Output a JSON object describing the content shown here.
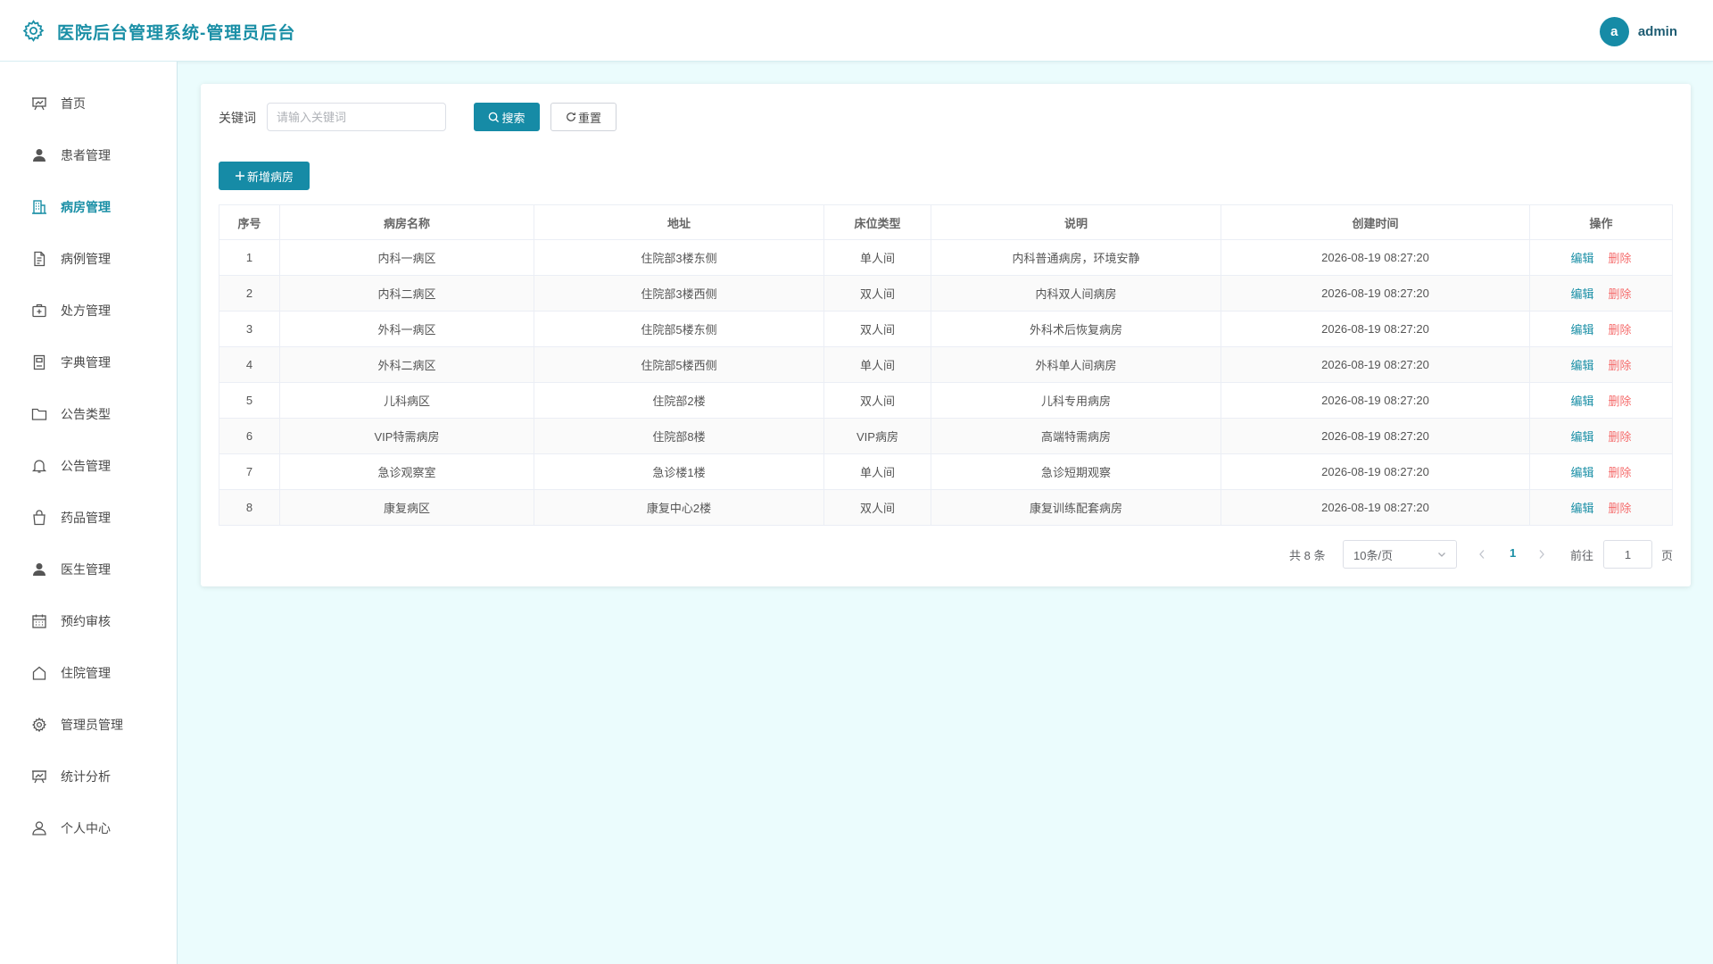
{
  "header": {
    "title": "医院后台管理系统-管理员后台",
    "avatar_letter": "a",
    "user_name": "admin"
  },
  "colors": {
    "accent": "#168ba6",
    "danger": "#f56c6c",
    "background": "#ebfcfd"
  },
  "sidebar": {
    "items": [
      {
        "label": "首页",
        "icon": "presentation-icon"
      },
      {
        "label": "患者管理",
        "icon": "user-filled-icon"
      },
      {
        "label": "病房管理",
        "icon": "building-icon",
        "active": true
      },
      {
        "label": "病例管理",
        "icon": "document-icon"
      },
      {
        "label": "处方管理",
        "icon": "first-aid-kit-icon"
      },
      {
        "label": "字典管理",
        "icon": "notebook-icon"
      },
      {
        "label": "公告类型",
        "icon": "folder-icon"
      },
      {
        "label": "公告管理",
        "icon": "bell-icon"
      },
      {
        "label": "药品管理",
        "icon": "shopping-bag-icon"
      },
      {
        "label": "医生管理",
        "icon": "user-filled-icon"
      },
      {
        "label": "预约审核",
        "icon": "calendar-icon"
      },
      {
        "label": "住院管理",
        "icon": "house-icon"
      },
      {
        "label": "管理员管理",
        "icon": "gear-icon"
      },
      {
        "label": "统计分析",
        "icon": "presentation-icon"
      },
      {
        "label": "个人中心",
        "icon": "user-icon"
      }
    ]
  },
  "search": {
    "label": "关键词",
    "placeholder": "请输入关键词",
    "search_label": "搜索",
    "reset_label": "重置"
  },
  "toolbar": {
    "add_label": "新增病房"
  },
  "table": {
    "headers": [
      "序号",
      "病房名称",
      "地址",
      "床位类型",
      "说明",
      "创建时间",
      "操作"
    ],
    "rows": [
      [
        "1",
        "内科一病区",
        "住院部3楼东侧",
        "单人间",
        "内科普通病房，环境安静",
        "2026-08-19 08:27:20"
      ],
      [
        "2",
        "内科二病区",
        "住院部3楼西侧",
        "双人间",
        "内科双人间病房",
        "2026-08-19 08:27:20"
      ],
      [
        "3",
        "外科一病区",
        "住院部5楼东侧",
        "双人间",
        "外科术后恢复病房",
        "2026-08-19 08:27:20"
      ],
      [
        "4",
        "外科二病区",
        "住院部5楼西侧",
        "单人间",
        "外科单人间病房",
        "2026-08-19 08:27:20"
      ],
      [
        "5",
        "儿科病区",
        "住院部2楼",
        "双人间",
        "儿科专用病房",
        "2026-08-19 08:27:20"
      ],
      [
        "6",
        "VIP特需病房",
        "住院部8楼",
        "VIP病房",
        "高端特需病房",
        "2026-08-19 08:27:20"
      ],
      [
        "7",
        "急诊观察室",
        "急诊楼1楼",
        "单人间",
        "急诊短期观察",
        "2026-08-19 08:27:20"
      ],
      [
        "8",
        "康复病区",
        "康复中心2楼",
        "双人间",
        "康复训练配套病房",
        "2026-08-19 08:27:20"
      ]
    ],
    "edit_label": "编辑",
    "delete_label": "删除"
  },
  "pagination": {
    "total_text": "共 8 条",
    "page_size": "10条/页",
    "current_page": "1",
    "goto_label": "前往",
    "goto_value": "1",
    "page_suffix": "页"
  }
}
